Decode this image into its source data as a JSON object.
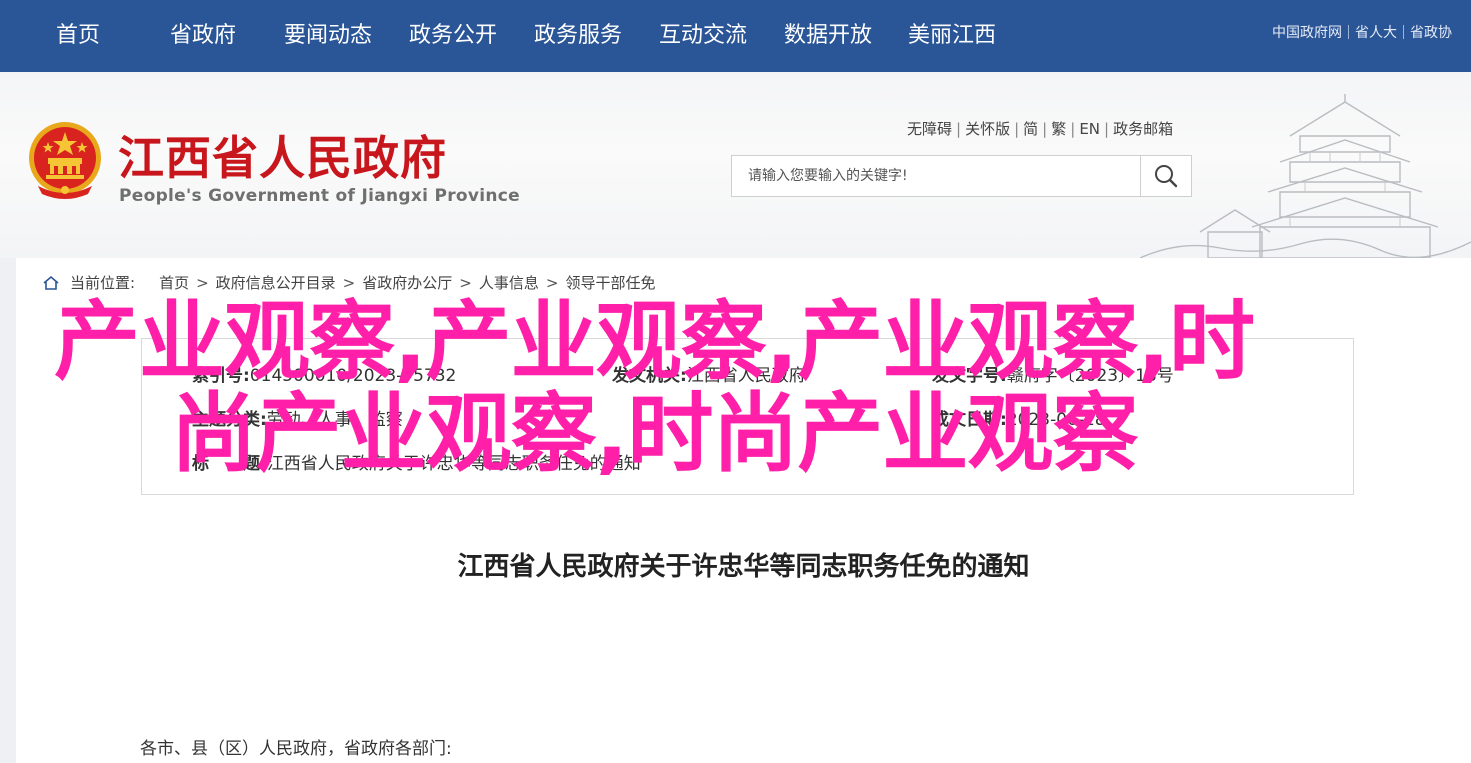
{
  "nav": {
    "items": [
      "首页",
      "省政府",
      "要闻动态",
      "政务公开",
      "政务服务",
      "互动交流",
      "数据开放",
      "美丽江西"
    ],
    "top_links": [
      "中国政府网",
      "省人大",
      "省政协"
    ]
  },
  "header": {
    "title": "江西省人民政府",
    "subtitle": "People's Government of Jiangxi Province",
    "util_links": [
      "无障碍",
      "关怀版",
      "简",
      "繁",
      "EN",
      "政务邮箱"
    ],
    "search": {
      "placeholder": "请输入您要输入的关键字!"
    }
  },
  "breadcrumb": {
    "lead": "当前位置:",
    "items": [
      "首页",
      "政府信息公开目录",
      "省政府办公厅",
      "人事信息",
      "领导干部任免"
    ]
  },
  "meta": {
    "index_label": "索引号:",
    "index_value": "014500010/2023-75732",
    "issuer_label": "发文机关:",
    "issuer_value": "江西省人民政府",
    "docno_label": "发文字号:",
    "docno_value": "赣府字〔2023〕18号",
    "topic_label": "主题分类:",
    "topic_value": "劳动、人事、监察",
    "date_label": "成文日期:",
    "date_value": "2023-06-28",
    "title_label": "标　　题:",
    "title_value": "江西省人民政府关于许忠华等同志职务任免的通知"
  },
  "document": {
    "title": "江西省人民政府关于许忠华等同志职务任免的通知",
    "salutation": "各市、县（区）人民政府，省政府各部门:"
  },
  "watermark": {
    "text": "产业观察,产业观察,产业观察,时尚产业观察,时尚产业观察"
  },
  "colors": {
    "nav_bg": "#2a5597",
    "title_red": "#c8161d",
    "watermark_pink": "#ff1fa8"
  }
}
